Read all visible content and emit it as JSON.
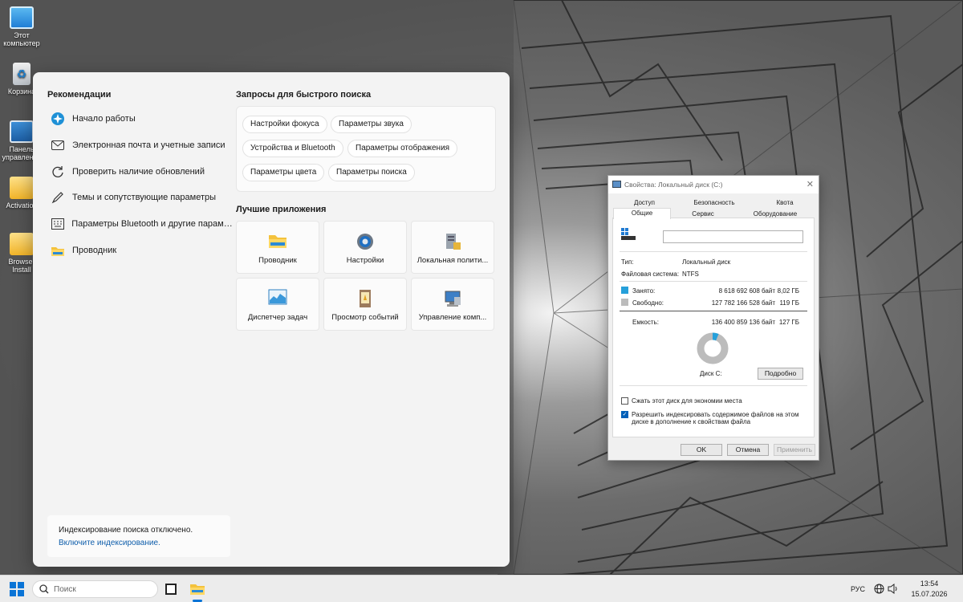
{
  "desktop": {
    "icons": [
      {
        "label": "Этот компьютер",
        "icon": "computer-icon"
      },
      {
        "label": "Корзина",
        "icon": "recycle-bin-icon"
      },
      {
        "label": "Панель управления",
        "icon": "control-panel-icon"
      },
      {
        "label": "Activation",
        "icon": "folder-icon"
      },
      {
        "label": "Browser Install",
        "icon": "folder-icon"
      }
    ]
  },
  "flyout": {
    "recommendations_title": "Рекомендации",
    "recommendations": [
      {
        "label": "Начало работы",
        "icon": "get-started-icon"
      },
      {
        "label": "Электронная почта и учетные записи",
        "icon": "mail-icon"
      },
      {
        "label": "Проверить наличие обновлений",
        "icon": "refresh-icon"
      },
      {
        "label": "Темы и сопутствующие параметры",
        "icon": "pen-icon"
      },
      {
        "label": "Параметры Bluetooth и другие параметр...",
        "icon": "keyboard-icon"
      },
      {
        "label": "Проводник",
        "icon": "folder-icon"
      }
    ],
    "quick_search_title": "Запросы для быстрого поиска",
    "quick_searches": [
      "Настройки фокуса",
      "Параметры звука",
      "Устройства и Bluetooth",
      "Параметры отображения",
      "Параметры цвета",
      "Параметры поиска"
    ],
    "top_apps_title": "Лучшие приложения",
    "top_apps": [
      {
        "label": "Проводник",
        "icon": "folder-icon"
      },
      {
        "label": "Настройки",
        "icon": "gear-icon"
      },
      {
        "label": "Локальная полити...",
        "icon": "policy-icon"
      },
      {
        "label": "Диспетчер задач",
        "icon": "task-manager-icon"
      },
      {
        "label": "Просмотр событий",
        "icon": "event-viewer-icon"
      },
      {
        "label": "Управление комп...",
        "icon": "computer-management-icon"
      }
    ],
    "indexing_message": "Индексирование поиска отключено.",
    "indexing_link": "Включите индексирование."
  },
  "dialog": {
    "title": "Свойства: Локальный диск (C:)",
    "tabs_row1": [
      "Доступ",
      "Безопасность",
      "Квота"
    ],
    "tabs_row2": [
      "Общие",
      "Сервис",
      "Оборудование"
    ],
    "active_tab": "Общие",
    "name_value": "",
    "type_label": "Тип:",
    "type_value": "Локальный диск",
    "fs_label": "Файловая система:",
    "fs_value": "NTFS",
    "used_label": "Занято:",
    "used_bytes": "8 618 692 608 байт",
    "used_gb": "8,02 ГБ",
    "free_label": "Свободно:",
    "free_bytes": "127 782 166 528 байт",
    "free_gb": "119 ГБ",
    "capacity_label": "Емкость:",
    "capacity_bytes": "136 400 859 136 байт",
    "capacity_gb": "127 ГБ",
    "disk_label": "Диск C:",
    "details_button": "Подробно",
    "compress_label": "Сжать этот диск для экономии места",
    "compress_checked": false,
    "index_label": "Разрешить индексировать содержимое файлов на этом диске в дополнение к свойствам файла",
    "index_checked": true,
    "used_color": "#26a0da",
    "free_color": "#bcbcbc",
    "used_fraction": 0.063,
    "ok_button": "OK",
    "cancel_button": "Отмена",
    "apply_button": "Применить"
  },
  "taskbar": {
    "search_placeholder": "Поиск",
    "language": "РУС",
    "time": "13:54",
    "date": "15.07.2026"
  }
}
